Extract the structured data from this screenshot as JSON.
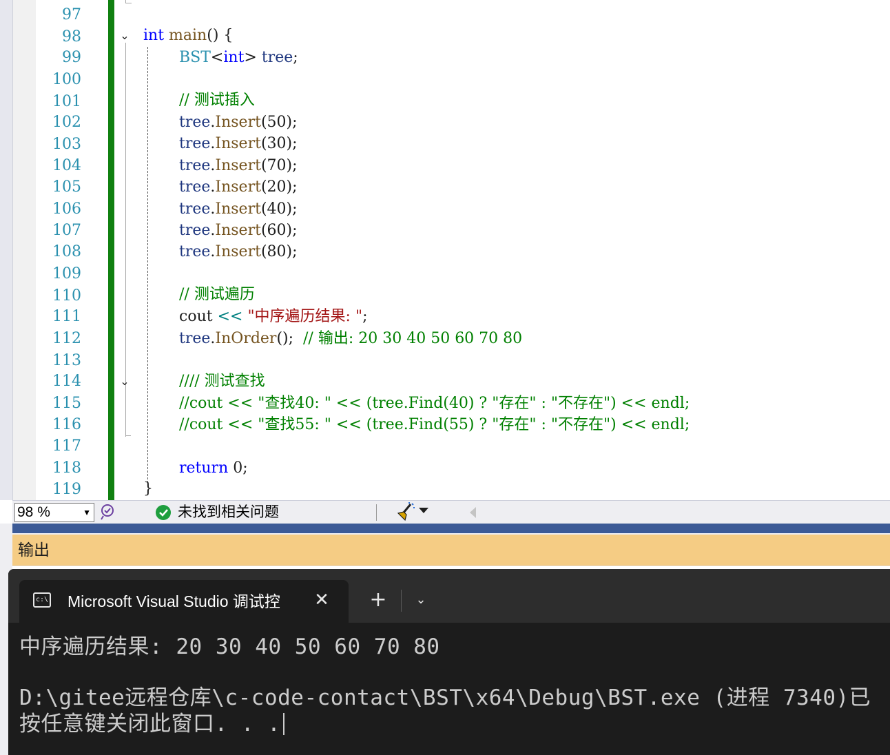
{
  "editor": {
    "line_numbers": [
      "97",
      "98",
      "99",
      "100",
      "101",
      "102",
      "103",
      "104",
      "105",
      "106",
      "107",
      "108",
      "109",
      "110",
      "111",
      "112",
      "113",
      "114",
      "115",
      "116",
      "117",
      "118",
      "119"
    ],
    "code": {
      "l98_kw": "int",
      "l98_fn": "main",
      "l98_rest": "() {",
      "l99_cls": "BST",
      "l99_lt": "<",
      "l99_kw": "int",
      "l99_gt": ">",
      "l99_var": "tree",
      "l99_end": ";",
      "l101_comment": "// 测试插入",
      "insert_obj": "tree",
      "insert_dot": ".",
      "insert_fn": "Insert",
      "l102_args": "(50);",
      "l103_args": "(30);",
      "l104_args": "(70);",
      "l105_args": "(20);",
      "l106_args": "(40);",
      "l107_args": "(60);",
      "l108_args": "(80);",
      "l110_comment": "// 测试遍历",
      "l111_cout": "cout",
      "l111_op": " << ",
      "l111_str": "\"中序遍历结果: \"",
      "l111_end": ";",
      "l112_obj": "tree",
      "l112_dot": ".",
      "l112_fn": "InOrder",
      "l112_call": "();  ",
      "l112_comment": "// 输出: 20 30 40 50 60 70 80",
      "l114_comment": "//// 测试查找",
      "l115_comment": "//cout << \"查找40: \" << (tree.Find(40) ? \"存在\" : \"不存在\") << endl;",
      "l116_comment": "//cout << \"查找55: \" << (tree.Find(55) ? \"存在\" : \"不存在\") << endl;",
      "l118_kw": "return",
      "l118_rest": " 0;",
      "l119_brace": "}"
    },
    "fold_icon": "chevron-down-icon"
  },
  "statusbar": {
    "zoom": "98 %",
    "issues_text": "未找到相关问题",
    "issues_icon": "check-circle-icon",
    "ok_color": "#1e9e3e"
  },
  "output": {
    "title": "输出"
  },
  "terminal": {
    "tab_title": "Microsoft Visual Studio 调试控",
    "tab_icon": "c:\\",
    "close_glyph": "✕",
    "new_tab_glyph": "+",
    "dropdown_glyph": "⌄",
    "lines": [
      "中序遍历结果: 20 30 40 50 60 70 80",
      "",
      "D:\\gitee远程仓库\\c-code-contact\\BST\\x64\\Debug\\BST.exe (进程 7340)已",
      "按任意键关闭此窗口. . ."
    ]
  },
  "colors": {
    "change_bar": "#108010",
    "line_number": "#2b91af",
    "keyword": "#0000ff",
    "comment": "#008000",
    "string": "#a31515",
    "output_header": "#f5cc84",
    "terminal_bg": "#1c1c1c"
  }
}
